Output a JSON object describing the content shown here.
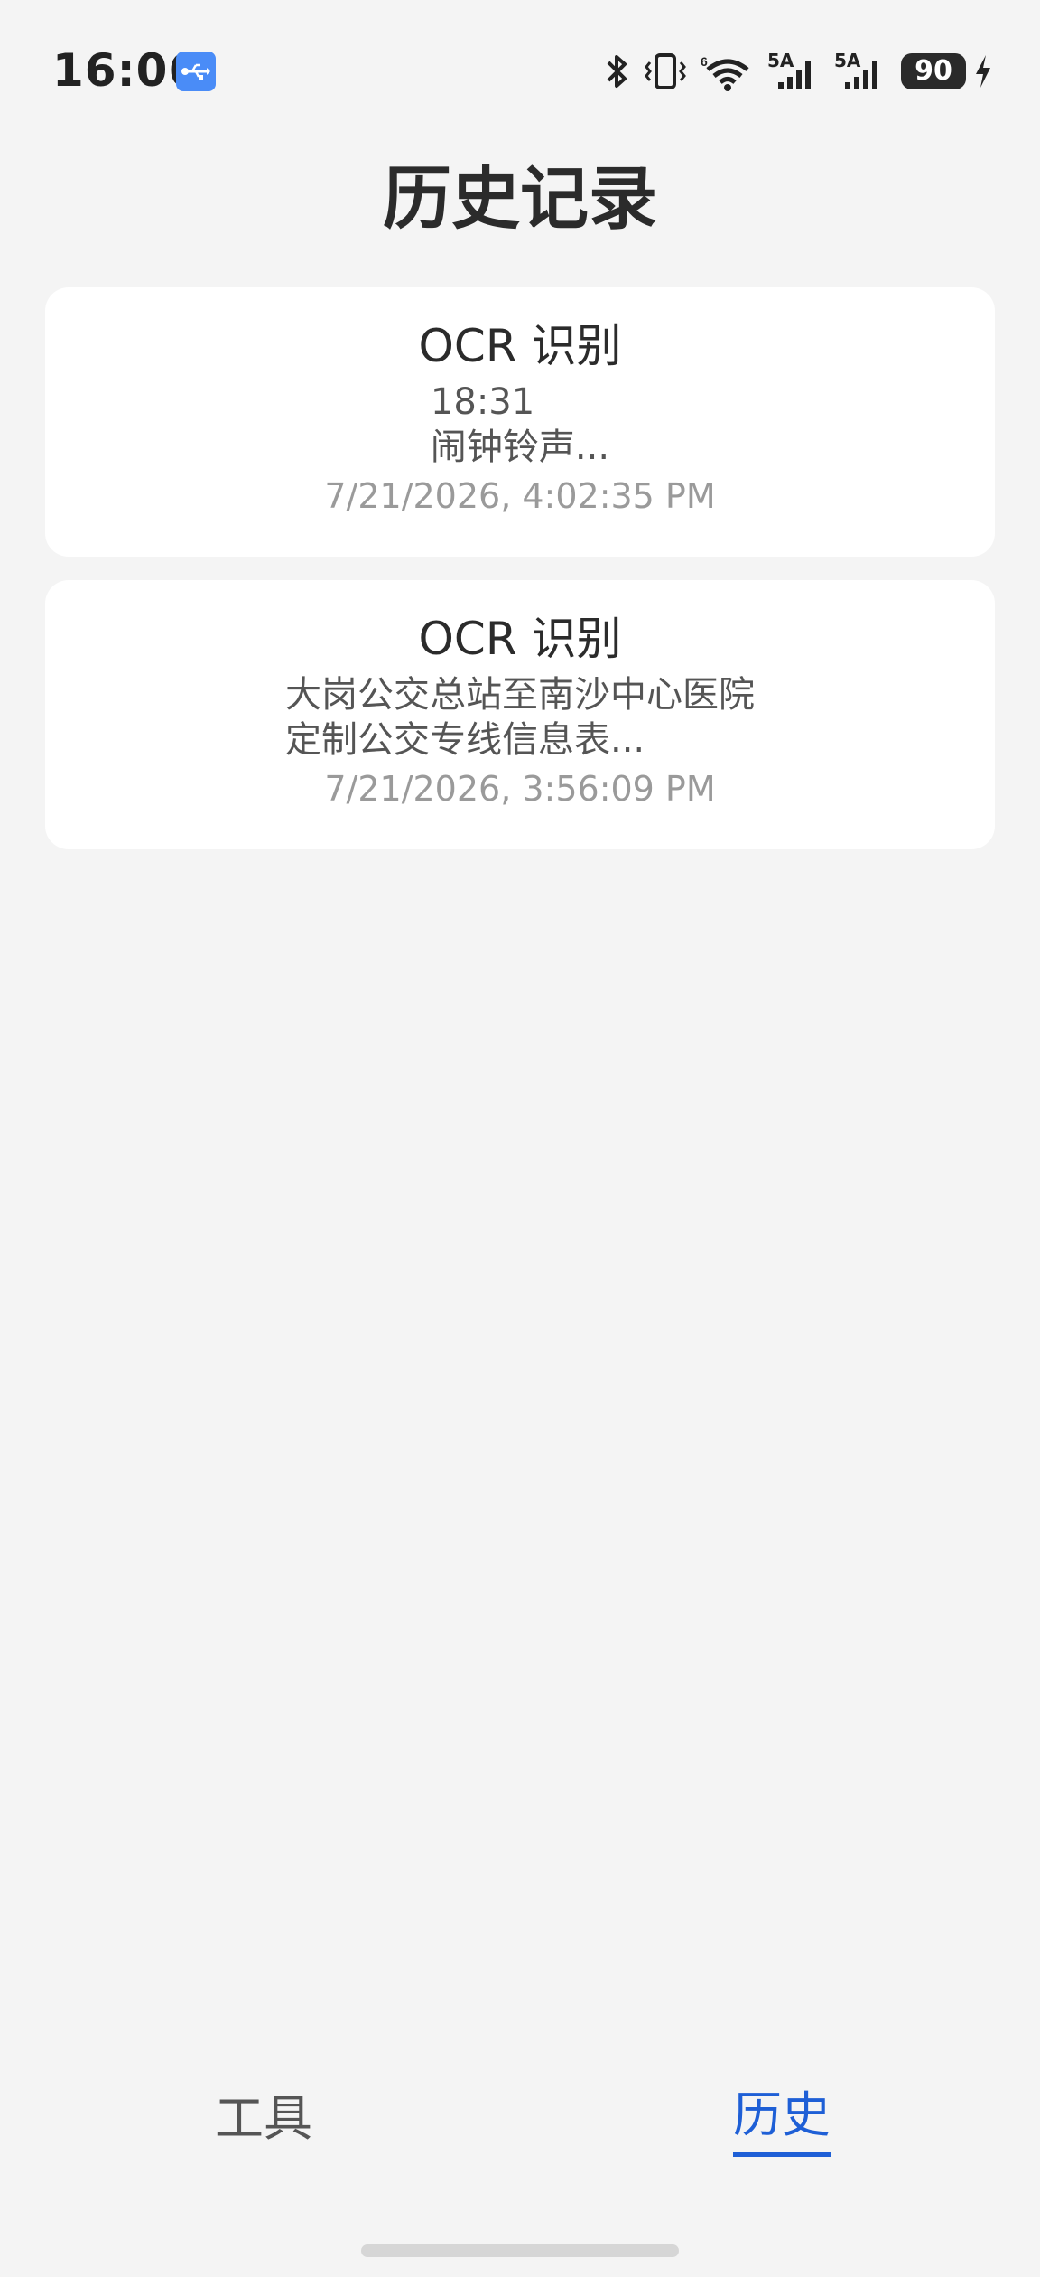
{
  "status_bar": {
    "time": "16:06",
    "icons": [
      "usb-icon",
      "bluetooth-icon",
      "vibrate-icon",
      "wifi-icon",
      "signal-5a-icon",
      "signal-5a-icon",
      "battery-icon",
      "charging-icon"
    ],
    "network_label_1": "5A",
    "network_label_2": "5A",
    "battery_level": "90",
    "accent_color": "#4a8cf7"
  },
  "page": {
    "title": "历史记录"
  },
  "history": {
    "items": [
      {
        "title": "OCR 识别",
        "preview": "18:31\n闹钟铃声...",
        "timestamp": "7/21/2026, 4:02:35 PM"
      },
      {
        "title": "OCR 识别",
        "preview": "大岗公交总站至南沙中心医院\n定制公交专线信息表...",
        "timestamp": "7/21/2026, 3:56:09 PM"
      }
    ]
  },
  "bottom_nav": {
    "tabs": [
      {
        "label": "工具",
        "active": false
      },
      {
        "label": "历史",
        "active": true
      }
    ],
    "active_color": "#1e5fd6"
  }
}
